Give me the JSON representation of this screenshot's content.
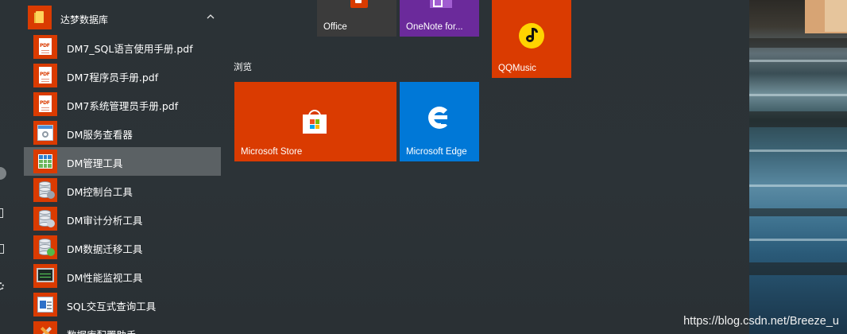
{
  "app_list": {
    "group": {
      "label": "达梦数据库",
      "icon": "folder-icon"
    },
    "items": [
      {
        "label": "DM7_SQL语言使用手册.pdf",
        "icon": "pdf-icon"
      },
      {
        "label": "DM7程序员手册.pdf",
        "icon": "pdf-icon"
      },
      {
        "label": "DM7系统管理员手册.pdf",
        "icon": "pdf-icon"
      },
      {
        "label": "DM服务查看器",
        "icon": "service-viewer-icon"
      },
      {
        "label": "DM管理工具",
        "icon": "grid-icon",
        "selected": true
      },
      {
        "label": "DM控制台工具",
        "icon": "database-icon"
      },
      {
        "label": "DM审计分析工具",
        "icon": "database-icon"
      },
      {
        "label": "DM数据迁移工具",
        "icon": "database-icon"
      },
      {
        "label": "DM性能监视工具",
        "icon": "monitor-icon"
      },
      {
        "label": "SQL交互式查询工具",
        "icon": "sql-query-icon"
      },
      {
        "label": "数据库配置助手",
        "icon": "wrench-icon"
      }
    ]
  },
  "tiles": {
    "section_label": "浏览",
    "office": {
      "label": "Office",
      "color": "#3b3b3b"
    },
    "onenote": {
      "label": "OneNote for...",
      "color": "#6b2a9b"
    },
    "qqmusic": {
      "label": "QQMusic",
      "color": "#da3b01"
    },
    "store": {
      "label": "Microsoft Store",
      "color": "#da3b01"
    },
    "edge": {
      "label": "Microsoft Edge",
      "color": "#0078d7"
    }
  },
  "watermark": "https://blog.csdn.net/Breeze_u",
  "colors": {
    "accent": "#da3b01",
    "selection": "#5b6164",
    "start_bg": "#2b3236"
  }
}
